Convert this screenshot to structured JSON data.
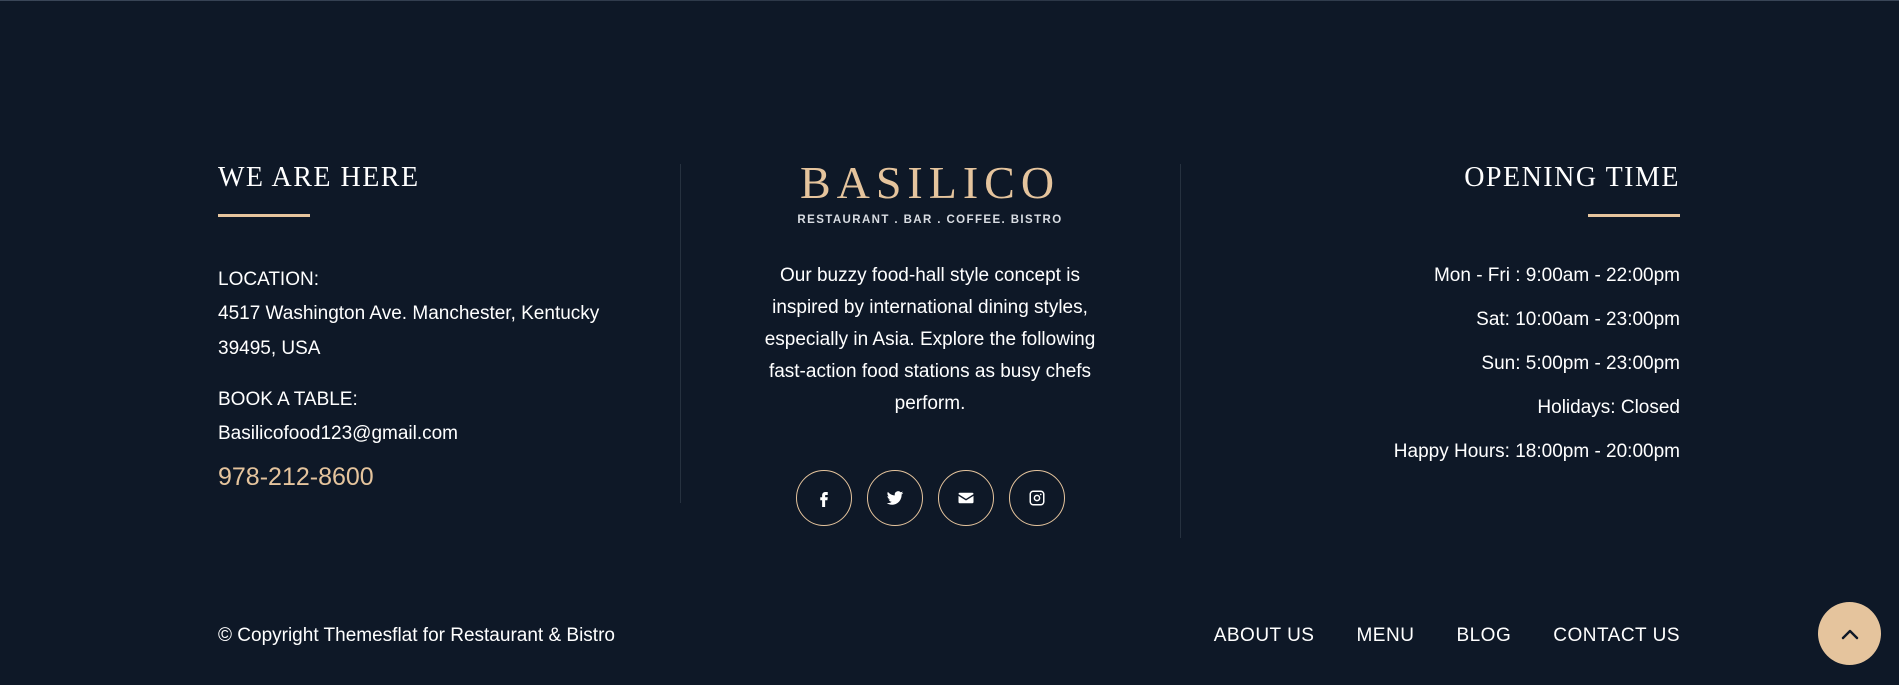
{
  "left": {
    "heading": "WE ARE HERE",
    "location_label": "LOCATION:",
    "address_line1": "4517 Washington Ave. Manchester, Kentucky",
    "address_line2": "39495, USA",
    "book_label": "BOOK A TABLE:",
    "email": "Basilicofood123@gmail.com",
    "phone": "978-212-8600"
  },
  "center": {
    "logo_word": "BASILICO",
    "logo_tagline": "RESTAURANT . BAR . COFFEE. BISTRO",
    "about_text": "Our buzzy food-hall style concept is inspired by international dining styles, especially in Asia. Explore the following fast-action food stations as busy chefs perform.",
    "socials": [
      {
        "icon": "facebook-icon"
      },
      {
        "icon": "twitter-icon"
      },
      {
        "icon": "envelope-icon"
      },
      {
        "icon": "instagram-icon"
      }
    ]
  },
  "right": {
    "heading": "OPENING TIME",
    "hours": [
      "Mon - Fri : 9:00am - 22:00pm",
      "Sat: 10:00am - 23:00pm",
      "Sun: 5:00pm - 23:00pm",
      "Holidays: Closed",
      "Happy Hours: 18:00pm - 20:00pm"
    ]
  },
  "bottom": {
    "copyright": "© Copyright Themesflat for Restaurant & Bistro",
    "nav": [
      "ABOUT US",
      "MENU",
      "BLOG",
      "CONTACT US"
    ]
  },
  "colors": {
    "background": "#0e1827",
    "accent": "#e5c49d",
    "text": "#ffffff"
  }
}
